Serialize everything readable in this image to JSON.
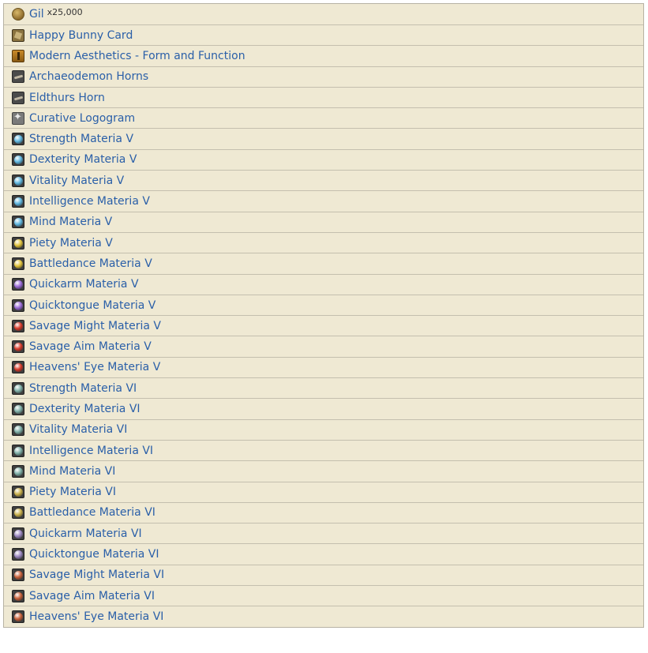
{
  "items": [
    {
      "label": "Gil",
      "qty": "x25,000",
      "icon": "gil-coin-icon",
      "kind": "coin"
    },
    {
      "label": "Happy Bunny Card",
      "qty": "",
      "icon": "card-icon",
      "kind": "card"
    },
    {
      "label": "Modern Aesthetics - Form and Function",
      "qty": "",
      "icon": "book-icon",
      "kind": "book"
    },
    {
      "label": "Archaeodemon Horns",
      "qty": "",
      "icon": "horn-icon",
      "kind": "horn"
    },
    {
      "label": "Eldthurs Horn",
      "qty": "",
      "icon": "horn-icon",
      "kind": "horn"
    },
    {
      "label": "Curative Logogram",
      "qty": "",
      "icon": "logogram-icon",
      "kind": "logo"
    },
    {
      "label": "Strength Materia V",
      "qty": "",
      "icon": "materia-icon",
      "kind": "orb",
      "color": "#5fb7e0"
    },
    {
      "label": "Dexterity Materia V",
      "qty": "",
      "icon": "materia-icon",
      "kind": "orb",
      "color": "#5fb7e0"
    },
    {
      "label": "Vitality Materia V",
      "qty": "",
      "icon": "materia-icon",
      "kind": "orb",
      "color": "#5fb7e0"
    },
    {
      "label": "Intelligence Materia V",
      "qty": "",
      "icon": "materia-icon",
      "kind": "orb",
      "color": "#5fb7e0"
    },
    {
      "label": "Mind Materia V",
      "qty": "",
      "icon": "materia-icon",
      "kind": "orb",
      "color": "#5fb7e0"
    },
    {
      "label": "Piety Materia V",
      "qty": "",
      "icon": "materia-icon",
      "kind": "orb",
      "color": "#e0c23a"
    },
    {
      "label": "Battledance Materia V",
      "qty": "",
      "icon": "materia-icon",
      "kind": "orb",
      "color": "#e0c23a"
    },
    {
      "label": "Quickarm Materia V",
      "qty": "",
      "icon": "materia-icon",
      "kind": "orb",
      "color": "#9a6ad8"
    },
    {
      "label": "Quicktongue Materia V",
      "qty": "",
      "icon": "materia-icon",
      "kind": "orb",
      "color": "#9a6ad8"
    },
    {
      "label": "Savage Might Materia V",
      "qty": "",
      "icon": "materia-icon",
      "kind": "orb",
      "color": "#d83a2a"
    },
    {
      "label": "Savage Aim Materia V",
      "qty": "",
      "icon": "materia-icon",
      "kind": "orb",
      "color": "#d83a2a"
    },
    {
      "label": "Heavens' Eye Materia V",
      "qty": "",
      "icon": "materia-icon",
      "kind": "orb",
      "color": "#d83a2a"
    },
    {
      "label": "Strength Materia VI",
      "qty": "",
      "icon": "materia-icon",
      "kind": "orb",
      "color": "#7fb0a8"
    },
    {
      "label": "Dexterity Materia VI",
      "qty": "",
      "icon": "materia-icon",
      "kind": "orb",
      "color": "#7fb0a8"
    },
    {
      "label": "Vitality Materia VI",
      "qty": "",
      "icon": "materia-icon",
      "kind": "orb",
      "color": "#7fb0a8"
    },
    {
      "label": "Intelligence Materia VI",
      "qty": "",
      "icon": "materia-icon",
      "kind": "orb",
      "color": "#7fb0a8"
    },
    {
      "label": "Mind Materia VI",
      "qty": "",
      "icon": "materia-icon",
      "kind": "orb",
      "color": "#7fb0a8"
    },
    {
      "label": "Piety Materia VI",
      "qty": "",
      "icon": "materia-icon",
      "kind": "orb",
      "color": "#c9b04a"
    },
    {
      "label": "Battledance Materia VI",
      "qty": "",
      "icon": "materia-icon",
      "kind": "orb",
      "color": "#c9b04a"
    },
    {
      "label": "Quickarm Materia VI",
      "qty": "",
      "icon": "materia-icon",
      "kind": "orb",
      "color": "#9a86c0"
    },
    {
      "label": "Quicktongue Materia VI",
      "qty": "",
      "icon": "materia-icon",
      "kind": "orb",
      "color": "#9a86c0"
    },
    {
      "label": "Savage Might Materia VI",
      "qty": "",
      "icon": "materia-icon",
      "kind": "orb",
      "color": "#c8603a"
    },
    {
      "label": "Savage Aim Materia VI",
      "qty": "",
      "icon": "materia-icon",
      "kind": "orb",
      "color": "#c8603a"
    },
    {
      "label": "Heavens' Eye Materia VI",
      "qty": "",
      "icon": "materia-icon",
      "kind": "orb",
      "color": "#c8603a"
    }
  ]
}
